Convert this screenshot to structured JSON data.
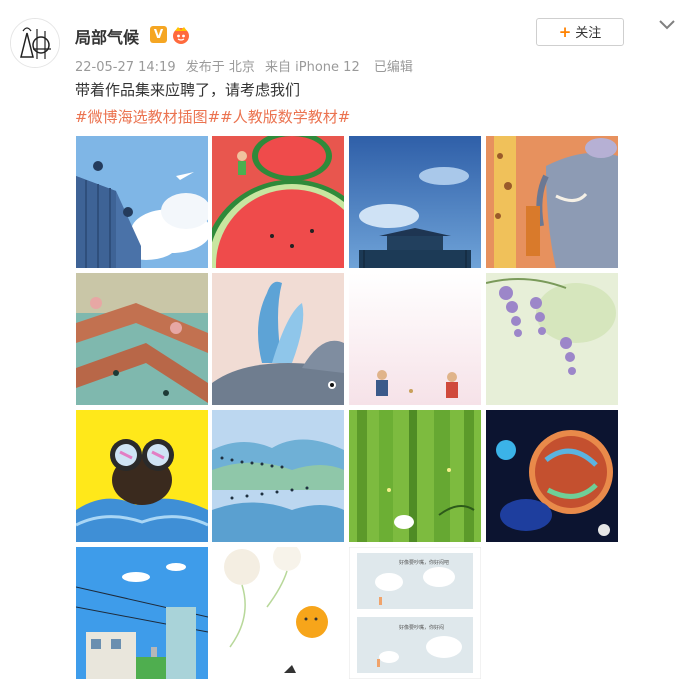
{
  "user": {
    "name": "局部气候",
    "vip_badge": "V"
  },
  "meta": {
    "time": "22-05-27 14:19",
    "location": "发布于 北京",
    "source": "来自 iPhone 12",
    "edited": "已编辑"
  },
  "follow_button": {
    "plus": "+",
    "label": "关注"
  },
  "post_text": "带着作品集来应聘了，请考虑我们",
  "hashtags": [
    "#微博海选教材插图#",
    "#人教版数学教材#"
  ],
  "images": [
    {
      "name": "building-sky-illustration"
    },
    {
      "name": "watermelon-illustration"
    },
    {
      "name": "palace-sky-illustration"
    },
    {
      "name": "giraffe-elephant-illustration"
    },
    {
      "name": "bridge-path-illustration"
    },
    {
      "name": "whale-spout-illustration"
    },
    {
      "name": "two-figures-illustration"
    },
    {
      "name": "wisteria-illustration"
    },
    {
      "name": "binoculars-illustration"
    },
    {
      "name": "birds-mountains-illustration"
    },
    {
      "name": "bamboo-forest-illustration"
    },
    {
      "name": "dark-planet-illustration"
    },
    {
      "name": "city-skyline-illustration"
    },
    {
      "name": "dandelion-chick-illustration"
    },
    {
      "name": "comic-clouds-illustration"
    }
  ],
  "comic": {
    "caption_top": "好像要吵嘴，你好闷吧",
    "caption_bottom": "好像要吵嘴，你好闷"
  },
  "colors": {
    "hashtag": "#eb7350",
    "follow_plus": "#ff8200",
    "vip": "#f5a623"
  }
}
